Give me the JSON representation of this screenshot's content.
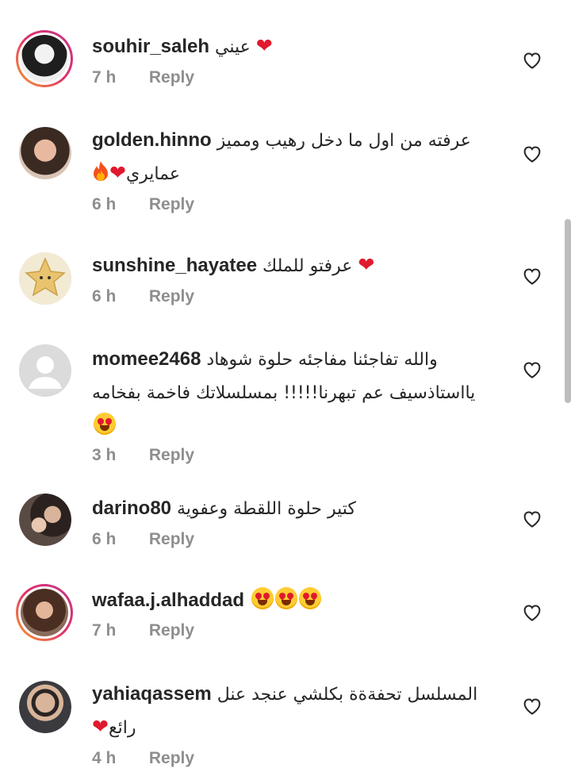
{
  "comments": [
    {
      "username": "souhir_saleh",
      "text": "عيني",
      "emoji": "heart",
      "time": "7 h",
      "reply": "Reply"
    },
    {
      "username": "golden.hinno",
      "text": "عرفته من اول ما دخل رهيب ومميز",
      "text2": "عمايري",
      "time": "6 h",
      "reply": "Reply"
    },
    {
      "username": "sunshine_hayatee",
      "text": "عرفتو للملك",
      "time": "6 h",
      "reply": "Reply"
    },
    {
      "username": "momee2468",
      "text": "والله تفاجئنا مفاجئه حلوة شوهاد",
      "text2": "يااستاذسيف عم تبهرنا!!!!! بمسلسلاتك فاخمة بفخامه",
      "time": "3 h",
      "reply": "Reply"
    },
    {
      "username": "darino80",
      "text": "كتير حلوة اللقطة وعفوية",
      "time": "6 h",
      "reply": "Reply"
    },
    {
      "username": "wafaa.j.alhaddad",
      "text": "",
      "time": "7 h",
      "reply": "Reply"
    },
    {
      "username": "yahiaqassem",
      "text": "المسلسل تحفةةة بكلشي عنجد عنل",
      "text2": "رائع",
      "time": "4 h",
      "reply": "Reply"
    }
  ],
  "colors": {
    "heart": "#e0192e",
    "meta": "#8e8e8e",
    "text": "#262626"
  }
}
